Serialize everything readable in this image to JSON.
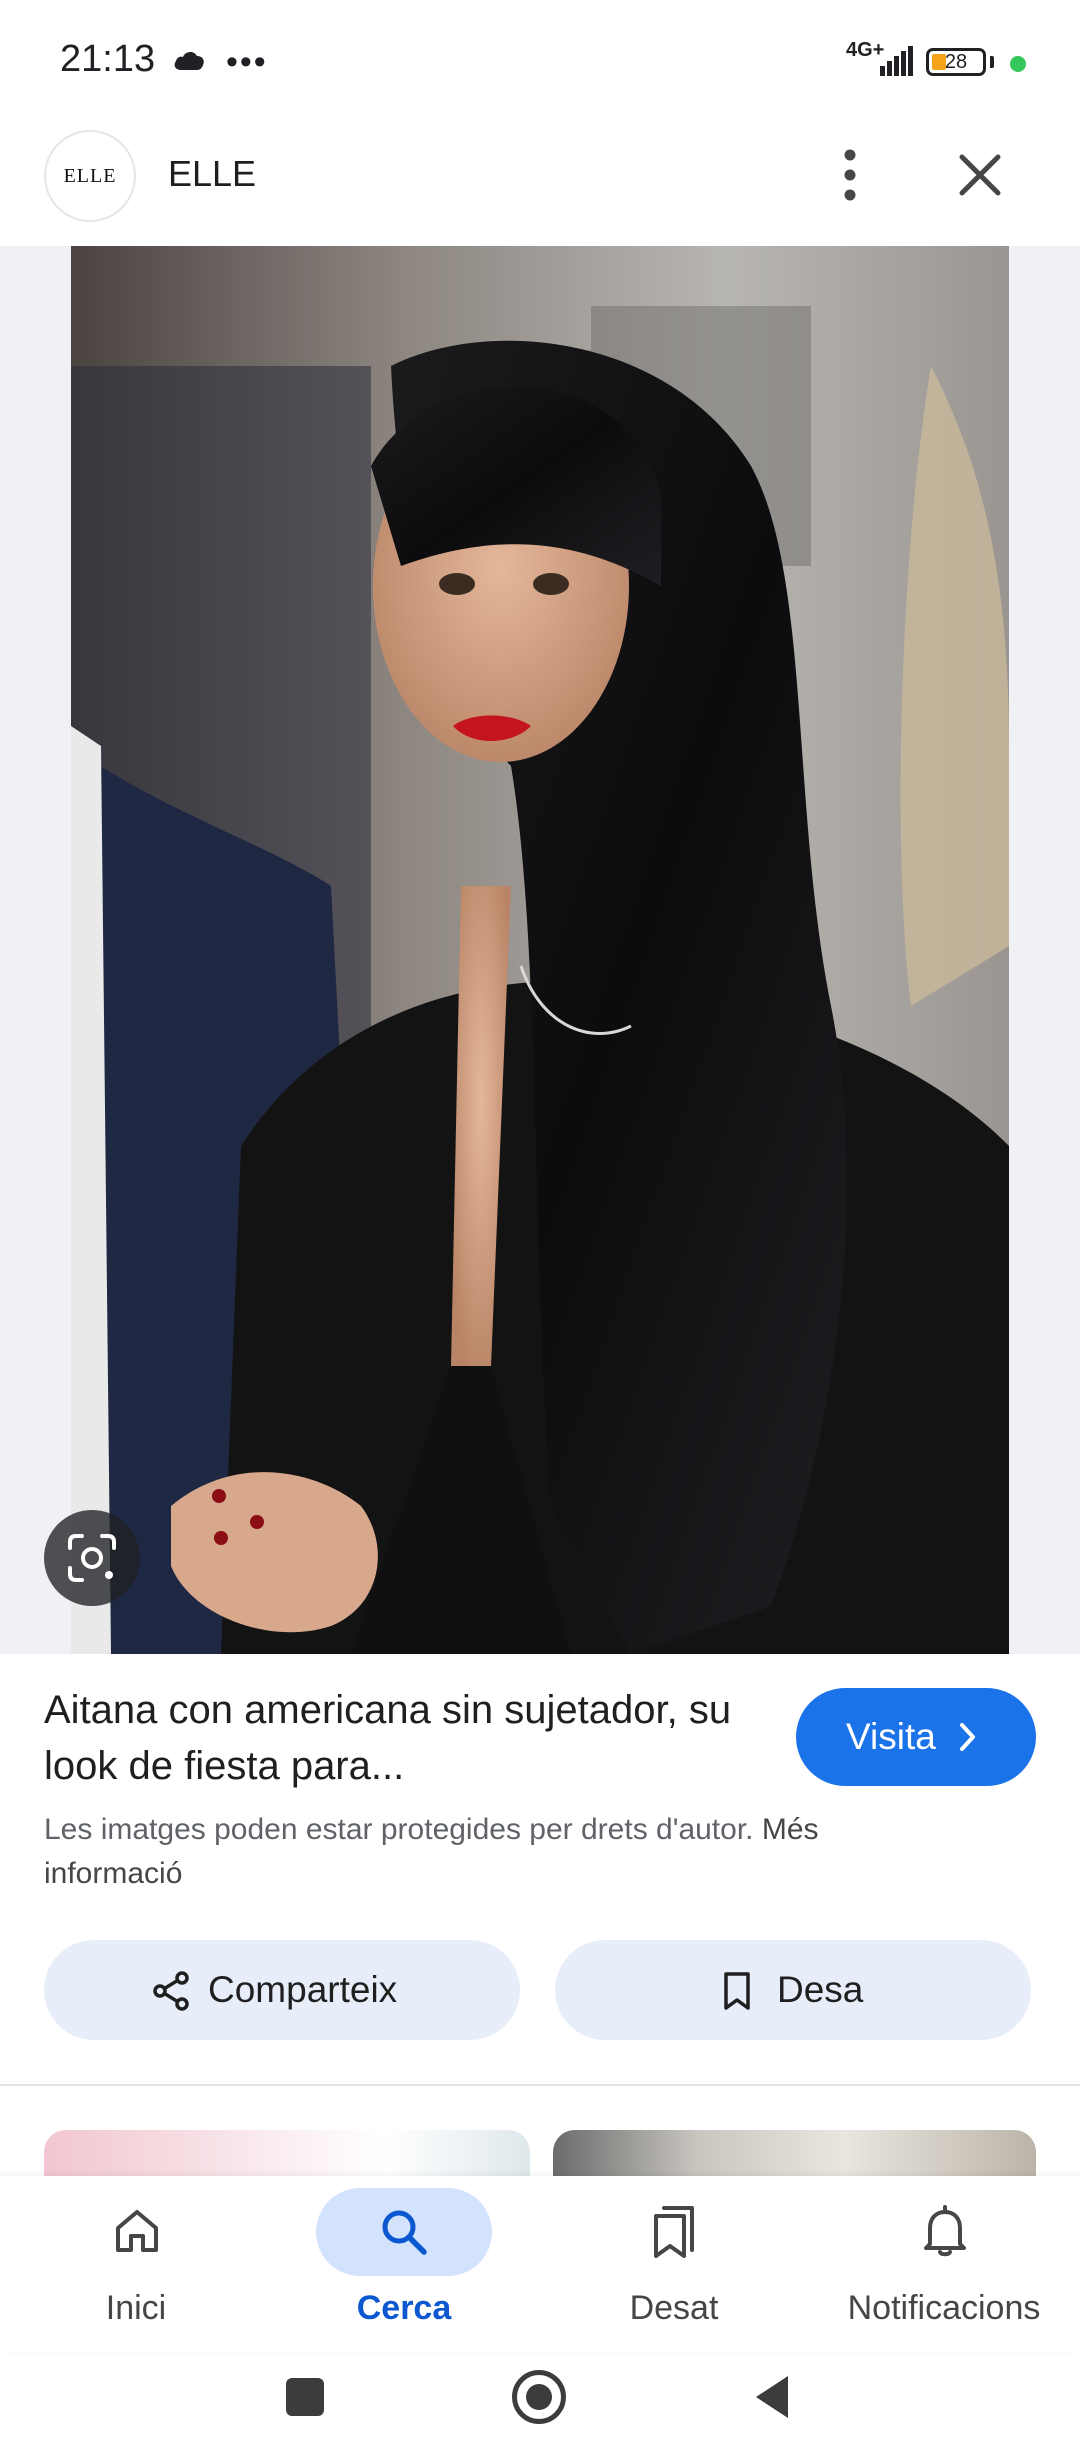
{
  "status_bar": {
    "time": "21:13",
    "network": "4G+",
    "battery": "28",
    "icons": [
      "cloud-icon",
      "more-dots-icon",
      "signal-icon",
      "battery-icon"
    ]
  },
  "header": {
    "logo_text": "ELLE",
    "site_name": "ELLE",
    "icons": [
      "more-vert-icon",
      "close-icon"
    ]
  },
  "result": {
    "title": "Aitana con americana sin sujetador, su look de fiesta para...",
    "visit_label": "Visita",
    "copyright_text": "Les imatges poden estar protegides per drets d'autor.",
    "more_info": "Més informació",
    "share_label": "Comparteix",
    "save_label": "Desa"
  },
  "bottom_nav": {
    "items": [
      {
        "label": "Inici",
        "icon": "home-icon",
        "active": false
      },
      {
        "label": "Cerca",
        "icon": "search-icon",
        "active": true
      },
      {
        "label": "Desat",
        "icon": "saved-icon",
        "active": false
      },
      {
        "label": "Notificacions",
        "icon": "bell-icon",
        "active": false
      }
    ]
  },
  "colors": {
    "accent": "#1a73e8",
    "active_nav": "#0b57d0",
    "chip_bg": "#e8eef9",
    "active_pill": "#d3e3fd"
  }
}
